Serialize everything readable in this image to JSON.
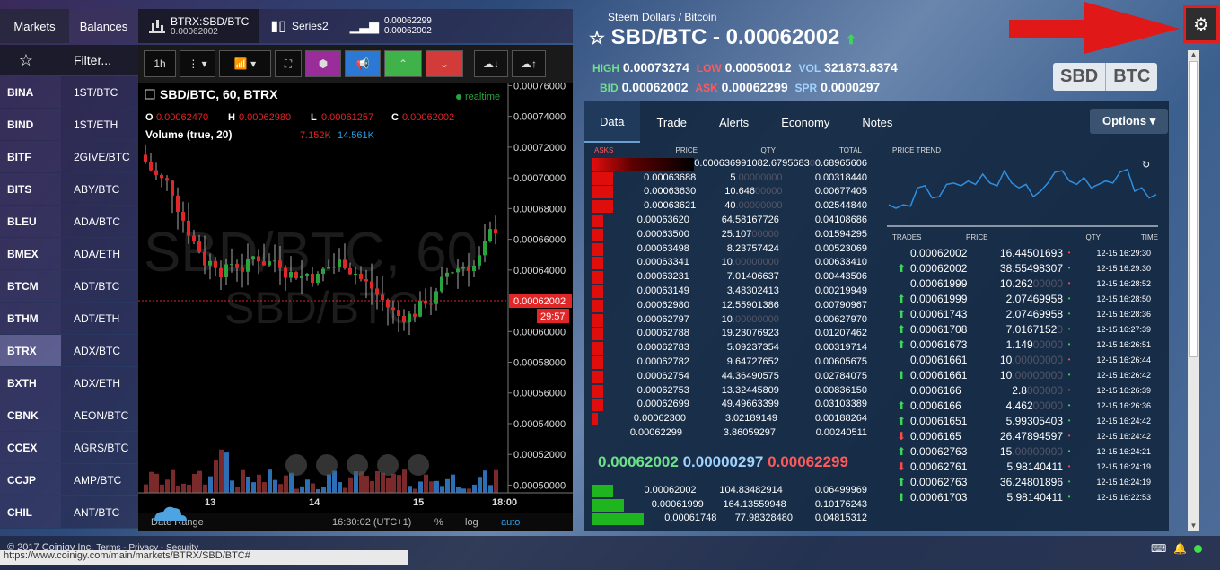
{
  "left_tabs": {
    "markets": "Markets",
    "balances": "Balances"
  },
  "header_tabs": [
    {
      "title": "BTRX:SBD/BTC",
      "sub": "0.00062002"
    },
    {
      "title": "Series2",
      "sub": ""
    },
    {
      "title": "0.00062299",
      "sub": "0.00062002"
    }
  ],
  "filter": {
    "label": "Filter..."
  },
  "markets": [
    {
      "ex": "BINA",
      "mk": "1ST/BTC"
    },
    {
      "ex": "BIND",
      "mk": "1ST/ETH"
    },
    {
      "ex": "BITF",
      "mk": "2GIVE/BTC"
    },
    {
      "ex": "BITS",
      "mk": "ABY/BTC"
    },
    {
      "ex": "BLEU",
      "mk": "ADA/BTC"
    },
    {
      "ex": "BMEX",
      "mk": "ADA/ETH"
    },
    {
      "ex": "BTCM",
      "mk": "ADT/BTC"
    },
    {
      "ex": "BTHM",
      "mk": "ADT/ETH"
    },
    {
      "ex": "BTRX",
      "mk": "ADX/BTC"
    },
    {
      "ex": "BXTH",
      "mk": "ADX/ETH"
    },
    {
      "ex": "CBNK",
      "mk": "AEON/BTC"
    },
    {
      "ex": "CCEX",
      "mk": "AGRS/BTC"
    },
    {
      "ex": "CCJP",
      "mk": "AMP/BTC"
    },
    {
      "ex": "CHIL",
      "mk": "ANT/BTC"
    }
  ],
  "chart": {
    "toolbar": {
      "interval": "1h"
    },
    "title": "SBD/BTC, 60, BTRX",
    "realtime": "realtime",
    "ohlc": {
      "o_label": "O",
      "o": "0.00062470",
      "h_label": "H",
      "h": "0.00062980",
      "l_label": "L",
      "l": "0.00061257",
      "c_label": "C",
      "c": "0.00062002"
    },
    "volume": {
      "label": "Volume (true, 20)",
      "v1": "7.152K",
      "v2": "14.561K"
    },
    "yticks": [
      "0.00076000",
      "0.00074000",
      "0.00072000",
      "0.00070000",
      "0.00068000",
      "0.00066000",
      "0.00064000",
      "0.00062002",
      "0.00060000",
      "0.00058000",
      "0.00056000",
      "0.00054000",
      "0.00052000",
      "0.00050000"
    ],
    "countdown": "29:57",
    "xticks": [
      "13",
      "14",
      "15",
      "18:00"
    ],
    "footer": {
      "range": "Date Range",
      "time": "16:30:02 (UTC+1)",
      "pct": "%",
      "log": "log",
      "auto": "auto"
    },
    "watermark1": "SBD/BTC, 60",
    "watermark2": "SBD/BTC"
  },
  "market": {
    "subtitle": "Steem Dollars / Bitcoin",
    "pair": "SBD/BTC - 0.00062002",
    "high_label": "HIGH",
    "high": "0.00073274",
    "low_label": "LOW",
    "low": "0.00050012",
    "vol_label": "VOL",
    "vol": "321873.8374",
    "bid_label": "BID",
    "bid": "0.00062002",
    "ask_label": "ASK",
    "ask": "0.00062299",
    "spr_label": "SPR",
    "spr": "0.0000297",
    "coin1": "SBD",
    "coin2": "BTC"
  },
  "data_tabs": [
    "Data",
    "Trade",
    "Alerts",
    "Economy",
    "Notes"
  ],
  "options": "Options",
  "asks_head": {
    "asks": "ASKS",
    "price": "PRICE",
    "qty": "QTY",
    "total": "TOTAL"
  },
  "asks": [
    {
      "price": "0.00063699",
      "qty": "1082.6795683",
      "qfade": "0",
      "total": "0.68965606",
      "bar": 1.0
    },
    {
      "price": "0.00063688",
      "qty": "5",
      "qfade": ".00000000",
      "total": "0.00318440",
      "bar": 0.08
    },
    {
      "price": "0.00063630",
      "qty": "10.646",
      "qfade": "00000",
      "total": "0.00677405",
      "bar": 0.08
    },
    {
      "price": "0.00063621",
      "qty": "40",
      "qfade": ".00000000",
      "total": "0.02544840",
      "bar": 0.08
    },
    {
      "price": "0.00063620",
      "qty": "64.58167726",
      "qfade": "",
      "total": "0.04108686",
      "bar": 0.04
    },
    {
      "price": "0.00063500",
      "qty": "25.107",
      "qfade": "00000",
      "total": "0.01594295",
      "bar": 0.04
    },
    {
      "price": "0.00063498",
      "qty": "8.23757424",
      "qfade": "",
      "total": "0.00523069",
      "bar": 0.04
    },
    {
      "price": "0.00063341",
      "qty": "10",
      "qfade": ".00000000",
      "total": "0.00633410",
      "bar": 0.04
    },
    {
      "price": "0.00063231",
      "qty": "7.01406637",
      "qfade": "",
      "total": "0.00443506",
      "bar": 0.04
    },
    {
      "price": "0.00063149",
      "qty": "3.48302413",
      "qfade": "",
      "total": "0.00219949",
      "bar": 0.04
    },
    {
      "price": "0.00062980",
      "qty": "12.55901386",
      "qfade": "",
      "total": "0.00790967",
      "bar": 0.04
    },
    {
      "price": "0.00062797",
      "qty": "10",
      "qfade": ".00000000",
      "total": "0.00627970",
      "bar": 0.04
    },
    {
      "price": "0.00062788",
      "qty": "19.23076923",
      "qfade": "",
      "total": "0.01207462",
      "bar": 0.04
    },
    {
      "price": "0.00062783",
      "qty": "5.09237354",
      "qfade": "",
      "total": "0.00319714",
      "bar": 0.04
    },
    {
      "price": "0.00062782",
      "qty": "9.64727652",
      "qfade": "",
      "total": "0.00605675",
      "bar": 0.04
    },
    {
      "price": "0.00062754",
      "qty": "44.36490575",
      "qfade": "",
      "total": "0.02784075",
      "bar": 0.04
    },
    {
      "price": "0.00062753",
      "qty": "13.32445809",
      "qfade": "",
      "total": "0.00836150",
      "bar": 0.04
    },
    {
      "price": "0.00062699",
      "qty": "49.49663399",
      "qfade": "",
      "total": "0.03103389",
      "bar": 0.04
    },
    {
      "price": "0.00062300",
      "qty": "3.02189149",
      "qfade": "",
      "total": "0.00188264",
      "bar": 0.02
    },
    {
      "price": "0.00062299",
      "qty": "3.86059297",
      "qfade": "",
      "total": "0.00240511",
      "bar": 0.0
    }
  ],
  "spread": {
    "bid": "0.00062002",
    "spr": "0.00000297",
    "ask": "0.00062299"
  },
  "bids": [
    {
      "price": "0.00062002",
      "qty": "104.83482914",
      "total": "0.06499969",
      "bar": 0.25
    },
    {
      "price": "0.00061999",
      "qty": "164.13559948",
      "total": "0.10176243",
      "bar": 0.4
    },
    {
      "price": "0.00061748",
      "qty": "77.98328480",
      "total": "0.04815312",
      "bar": 0.7
    }
  ],
  "trend": {
    "label": "PRICE TREND",
    "values": [
      0.3,
      0.25,
      0.3,
      0.28,
      0.55,
      0.58,
      0.4,
      0.42,
      0.6,
      0.62,
      0.58,
      0.65,
      0.6,
      0.75,
      0.62,
      0.58,
      0.8,
      0.62,
      0.55,
      0.6,
      0.42,
      0.5,
      0.62,
      0.78,
      0.8,
      0.65,
      0.6,
      0.7,
      0.55,
      0.6,
      0.65,
      0.62,
      0.78,
      0.82,
      0.5,
      0.55,
      0.4,
      0.45
    ]
  },
  "trades_head": {
    "trades": "TRADES",
    "price": "PRICE",
    "qty": "QTY",
    "time": "TIME"
  },
  "trades": [
    {
      "dir": "",
      "price": "0.00062002",
      "qty": "16.44501693",
      "qfade": "",
      "time": "12-15 16:29:30"
    },
    {
      "dir": "up",
      "price": "0.00062002",
      "qty": "38.55498307",
      "qfade": "",
      "time": "12-15 16:29:30"
    },
    {
      "dir": "",
      "price": "0.00061999",
      "qty": "10.262",
      "qfade": "00000",
      "time": "12-15 16:28:52"
    },
    {
      "dir": "up",
      "price": "0.00061999",
      "qty": "2.07469958",
      "qfade": "",
      "time": "12-15 16:28:50"
    },
    {
      "dir": "up",
      "price": "0.00061743",
      "qty": "2.07469958",
      "qfade": "",
      "time": "12-15 16:28:36"
    },
    {
      "dir": "up",
      "price": "0.00061708",
      "qty": "7.0167152",
      "qfade": "0",
      "time": "12-15 16:27:39"
    },
    {
      "dir": "up",
      "price": "0.00061673",
      "qty": "1.149",
      "qfade": "00000",
      "time": "12-15 16:26:51"
    },
    {
      "dir": "",
      "price": "0.00061661",
      "qty": "10",
      "qfade": ".00000000",
      "time": "12-15 16:26:44"
    },
    {
      "dir": "up",
      "price": "0.00061661",
      "qty": "10",
      "qfade": ".00000000",
      "time": "12-15 16:26:42"
    },
    {
      "dir": "",
      "price": "0.0006166",
      "qty": "2.8",
      "qfade": "000000",
      "time": "12-15 16:26:39"
    },
    {
      "dir": "up",
      "price": "0.0006166",
      "qty": "4.462",
      "qfade": "00000",
      "time": "12-15 16:26:36"
    },
    {
      "dir": "up",
      "price": "0.00061651",
      "qty": "5.99305403",
      "qfade": "",
      "time": "12-15 16:24:42"
    },
    {
      "dir": "down",
      "price": "0.0006165",
      "qty": "26.47894597",
      "qfade": "",
      "time": "12-15 16:24:42"
    },
    {
      "dir": "up",
      "price": "0.00062763",
      "qty": "15",
      "qfade": ".00000000",
      "time": "12-15 16:24:21"
    },
    {
      "dir": "down",
      "price": "0.00062761",
      "qty": "5.98140411",
      "qfade": "",
      "time": "12-15 16:24:19"
    },
    {
      "dir": "up",
      "price": "0.00062763",
      "qty": "36.24801896",
      "qfade": "",
      "time": "12-15 16:24:19"
    },
    {
      "dir": "up",
      "price": "0.00061703",
      "qty": "5.98140411",
      "qfade": "",
      "time": "12-15 16:22:53"
    }
  ],
  "footer": {
    "copyright": "© 2017 Coinigy Inc.",
    "links": "Terms - Privacy - Security",
    "url": "https://www.coinigy.com/main/markets/BTRX/SBD/BTC#"
  },
  "colors": {
    "up": "#26a63a",
    "down": "#e02626",
    "ask_bar": "#e00d0d",
    "bid_bar": "#1fb51f"
  }
}
